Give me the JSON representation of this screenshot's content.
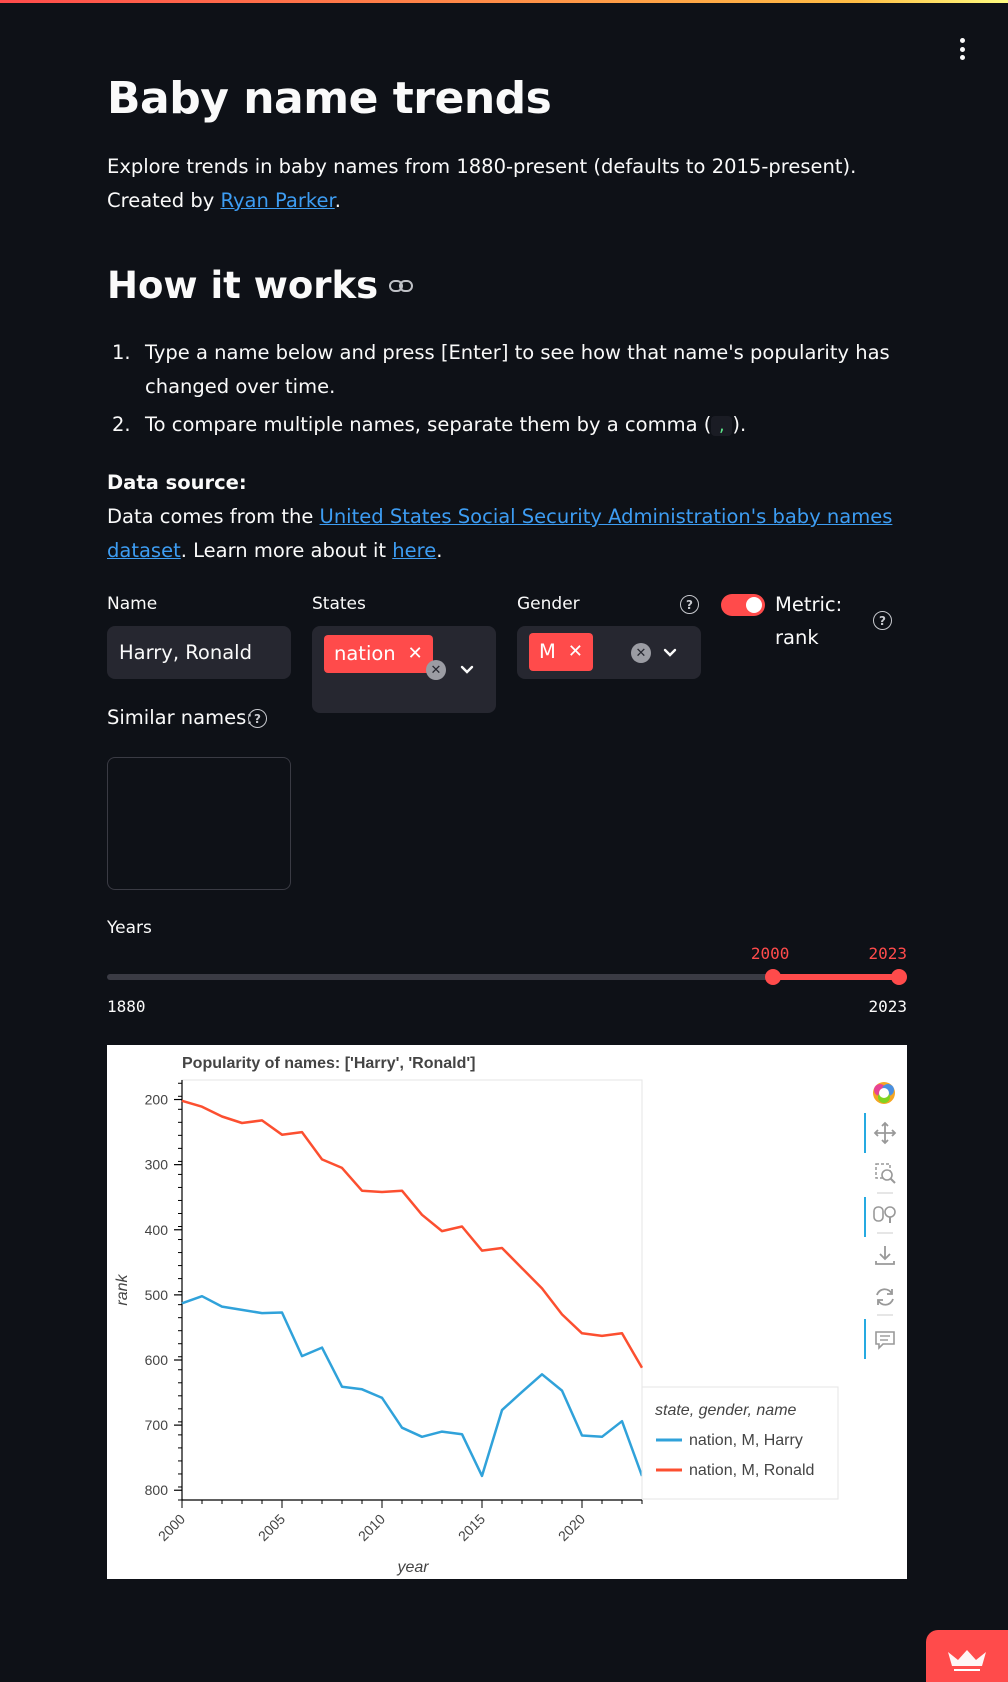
{
  "app": {
    "title": "Baby name trends",
    "intro_text": "Explore trends in baby names from 1880-present (defaults to 2015-present). Created by ",
    "intro_link": "Ryan Parker",
    "intro_end": ".",
    "menu_icon": "kebab-menu-icon"
  },
  "how": {
    "heading": "How it works",
    "link_icon": "link-icon",
    "steps": [
      {
        "num": "1.",
        "text": "Type a name below and press [Enter] to see how that name's popularity has changed over time."
      },
      {
        "num": "2.",
        "text_before": "To compare multiple names, separate them by a comma (",
        "code": ",",
        "text_after": ")."
      }
    ]
  },
  "data_source": {
    "title": "Data source:",
    "text_before": "Data comes from the ",
    "link": "United States Social Security Administration's baby names dataset",
    "text_mid": ". Learn more about it ",
    "link2": "here",
    "text_end": "."
  },
  "controls": {
    "name": {
      "label": "Name",
      "value": "Harry, Ronald"
    },
    "states": {
      "label": "States",
      "selected": [
        "nation"
      ]
    },
    "gender": {
      "label": "Gender",
      "selected": [
        "M"
      ]
    },
    "metric": {
      "label": "Metric: rank",
      "on": true
    },
    "similar": {
      "label": "Similar names:",
      "value": ""
    },
    "years": {
      "label": "Years",
      "min": "1880",
      "max": "2023",
      "low": "2000",
      "high": "2023",
      "low_value": 2000,
      "high_value": 2023,
      "range_min": 1880,
      "range_max": 2023
    }
  },
  "colors": {
    "accent": "#ff4b4b",
    "link": "#3d9df3",
    "harry": "#30a2da",
    "ronald": "#fc4f30"
  },
  "chart_data": {
    "type": "line",
    "title": "Popularity of names: ['Harry', 'Ronald']",
    "xlabel": "year",
    "ylabel": "rank",
    "xlim": [
      2000,
      2023
    ],
    "ylim": [
      170,
      815
    ],
    "y_inverted": true,
    "x_ticks": [
      2000,
      2005,
      2010,
      2015,
      2020
    ],
    "y_ticks": [
      200,
      300,
      400,
      500,
      600,
      700,
      800
    ],
    "legend_title": "state, gender, name",
    "legend_position": "bottom-right",
    "x": [
      2000,
      2001,
      2002,
      2003,
      2004,
      2005,
      2006,
      2007,
      2008,
      2009,
      2010,
      2011,
      2012,
      2013,
      2014,
      2015,
      2016,
      2017,
      2018,
      2019,
      2020,
      2021,
      2022,
      2023
    ],
    "series": [
      {
        "name": "nation, M, Harry",
        "values": [
          513,
          502,
          518,
          523,
          528,
          527,
          594,
          581,
          641,
          645,
          658,
          704,
          718,
          710,
          714,
          778,
          677,
          649,
          622,
          647,
          716,
          718,
          694,
          778
        ]
      },
      {
        "name": "nation, M, Ronald",
        "values": [
          202,
          211,
          226,
          236,
          232,
          254,
          250,
          292,
          305,
          340,
          342,
          340,
          377,
          402,
          395,
          432,
          428,
          459,
          490,
          530,
          559,
          563,
          559,
          612
        ]
      }
    ]
  },
  "toolbar_icons": [
    "bokeh-logo-icon",
    "pan-icon",
    "box-zoom-icon",
    "wheel-zoom-icon",
    "save-icon",
    "reset-icon",
    "hover-icon"
  ],
  "fab_icon": "streamlit-crown-icon"
}
